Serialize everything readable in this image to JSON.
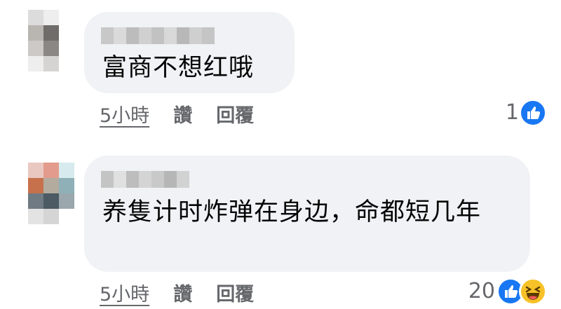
{
  "comments": [
    {
      "text": "富商不想红哦",
      "time": "5小時",
      "like_label": "讚",
      "reply_label": "回覆",
      "reaction_count": "1",
      "reactions": [
        "like-icon"
      ]
    },
    {
      "text": "养隻计时炸弹在身边，命都短几年",
      "time": "5小時",
      "like_label": "讚",
      "reply_label": "回覆",
      "reaction_count": "20",
      "reactions": [
        "like-icon",
        "haha-icon"
      ]
    }
  ],
  "colors": {
    "bubble": "#f0f2f5",
    "like_blue": "#1877f2",
    "haha_yellow": "#f7c227",
    "meta_gray": "#65676b"
  }
}
